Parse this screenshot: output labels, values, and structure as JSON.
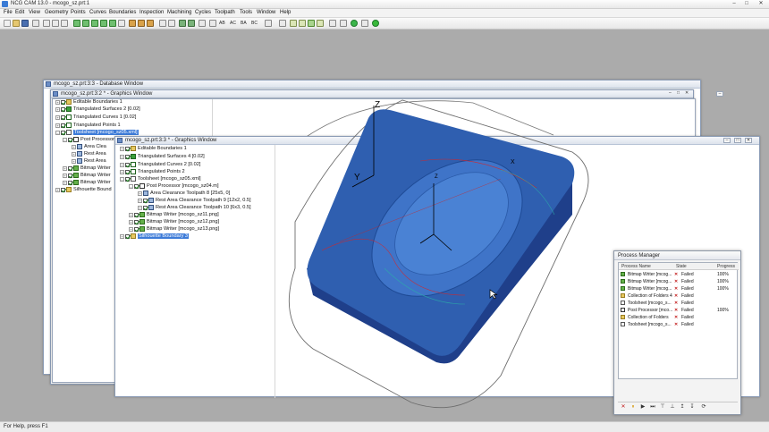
{
  "app": {
    "title": "NCG CAM 13.0 - mcogo_sz.prt:1",
    "window_controls": [
      "–",
      "□",
      "✕"
    ]
  },
  "menu": [
    "File",
    "Edit",
    "View",
    "Geometry",
    "Points",
    "Curves",
    "Boundaries",
    "Inspection",
    "Machining",
    "Cycles",
    "Toolpath",
    "Tools",
    "Window",
    "Help"
  ],
  "toolbar": {
    "text_buttons": [
      "AB",
      "AC",
      "BA",
      "BC"
    ]
  },
  "windows": {
    "database": {
      "title": "mcogo_sz.prt:3:3 - Database Window"
    },
    "graphics_back": {
      "title": "mcogo_sz.prt:3:2 * - Graphics Window"
    },
    "graphics_front": {
      "title": "mcogo_sz.prt:3:3 * - Graphics Window"
    }
  },
  "tree_back": [
    "Editable Boundaries 1",
    "Triangulated Surfaces 2 [0.02]",
    "Triangulated Curves 1 [0.02]",
    "Triangulated Points 1",
    "Toolsheet [mcogo_sz05.xml]",
    "Post Processor",
    "Area Clea",
    "Rest Area",
    "Rest Area",
    "Bitmap Writer",
    "Bitmap Writer",
    "Bitmap Writer",
    "Silhouette Bound"
  ],
  "tree_front": [
    "Editable Boundaries 1",
    "Triangulated Surfaces 4 [0.02]",
    "Triangulated Curves 2 [0.02]",
    "Triangulated Points 2",
    "Toolsheet [mcogo_sz05.xml]",
    "Post Processor [mcogo_sz04.m]",
    "Area Clearance Toolpath 8 [25x5, 0]",
    "Rest Area Clearance Toolpath 9 [12x2, 0.5]",
    "Rest Area Clearance Toolpath 10 [6x3, 0.5]",
    "Bitmap Writer [mcogo_sz11.png]",
    "Bitmap Writer [mcogo_sz12.png]",
    "Bitmap Writer [mcogo_sz13.png]",
    "Silhouette Boundary 3"
  ],
  "axes": {
    "x": "X",
    "y": "Y",
    "z": "Z"
  },
  "process_manager": {
    "title": "Process Manager",
    "columns": [
      "Process Name",
      "State",
      "Progress"
    ],
    "rows": [
      {
        "name": "Bitmap Writer [mcog...",
        "state": "Failed",
        "progress": "100%"
      },
      {
        "name": "Bitmap Writer [mcog...",
        "state": "Failed",
        "progress": "100%"
      },
      {
        "name": "Bitmap Writer [mcog...",
        "state": "Failed",
        "progress": "100%"
      },
      {
        "name": "Collection of Folders 4",
        "state": "Failed",
        "progress": ""
      },
      {
        "name": "Toolsheet [mcogo_s...",
        "state": "Failed",
        "progress": ""
      },
      {
        "name": "Post Processor [mco...",
        "state": "Failed",
        "progress": "100%"
      },
      {
        "name": "Collection of Folders",
        "state": "Failed",
        "progress": ""
      },
      {
        "name": "Toolsheet [mcogo_s...",
        "state": "Failed",
        "progress": ""
      }
    ],
    "footer_buttons": [
      "✕",
      "⏸",
      "▶",
      "⏭",
      "⊤",
      "⊥",
      "↥",
      "↧",
      "⟳"
    ]
  },
  "status": {
    "text": "For Help, press F1"
  },
  "colors": {
    "part_blue": "#2f5fb0",
    "selection": "#3d7bd8",
    "failed": "#c21a1a"
  }
}
